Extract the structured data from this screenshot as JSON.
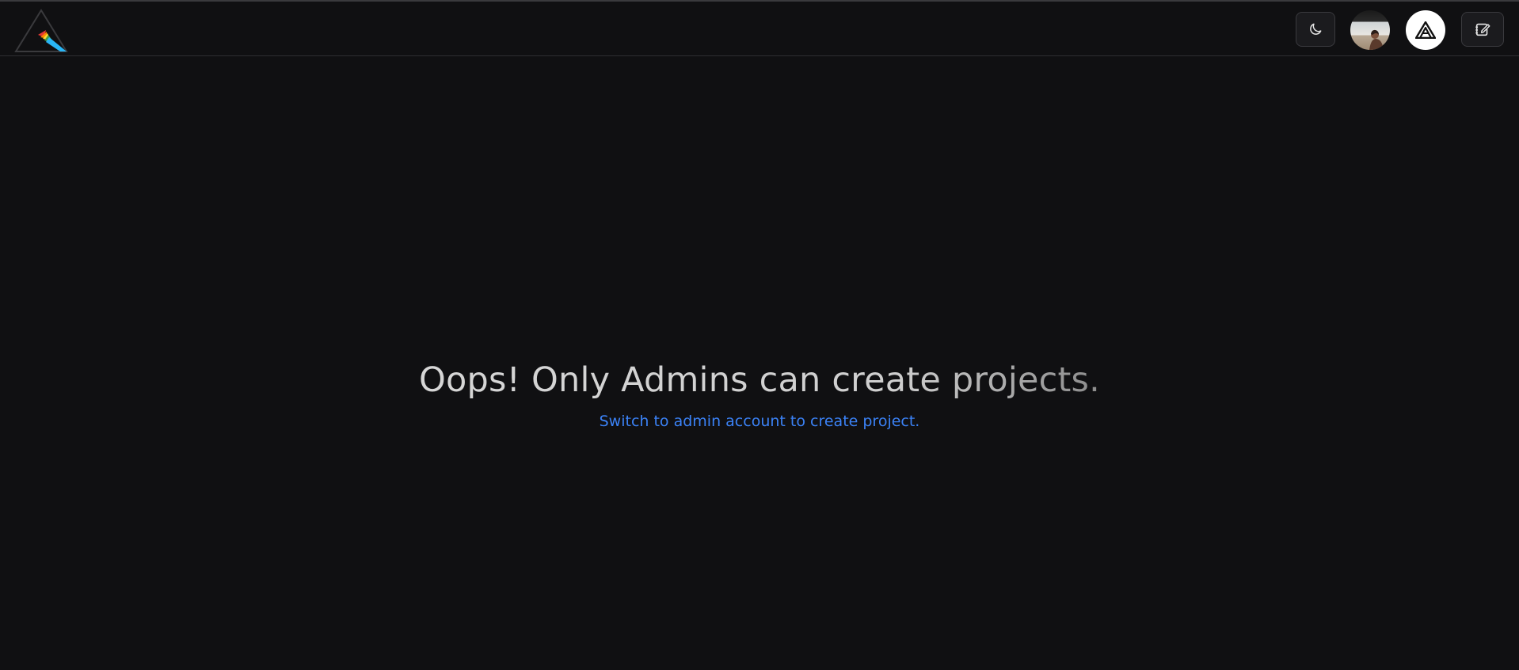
{
  "header": {
    "logo_icon": "prism-logo-icon",
    "theme_toggle_icon": "moon-icon",
    "user_avatar_icon": "user-photo-avatar",
    "org_avatar_icon": "org-logo-icon",
    "compose_icon": "edit-note-icon"
  },
  "main": {
    "title": "Oops! Only Admins can create projects.",
    "link_text": "Switch to admin account to create project."
  },
  "colors": {
    "background": "#101012",
    "link": "#3b82f6",
    "title": "#d6d6d6"
  }
}
